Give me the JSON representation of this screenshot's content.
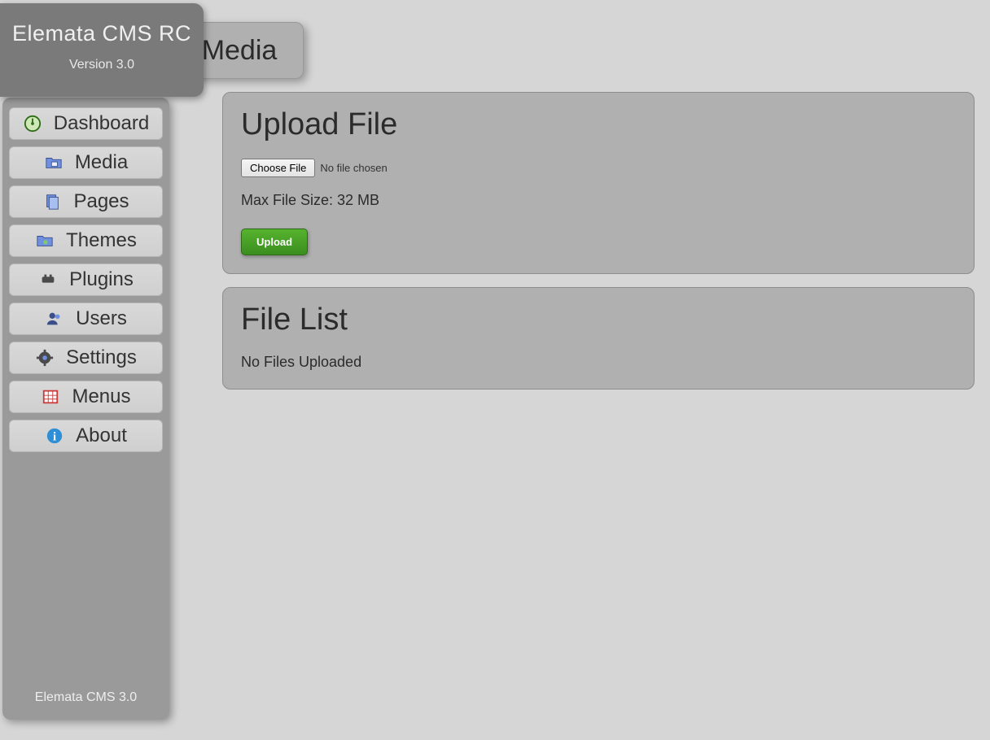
{
  "brand": {
    "title": "Elemata CMS RC",
    "version": "Version 3.0"
  },
  "sidebar": {
    "items": [
      {
        "label": "Dashboard",
        "icon": "dashboard-icon"
      },
      {
        "label": "Media",
        "icon": "media-icon"
      },
      {
        "label": "Pages",
        "icon": "pages-icon"
      },
      {
        "label": "Themes",
        "icon": "themes-icon"
      },
      {
        "label": "Plugins",
        "icon": "plugins-icon"
      },
      {
        "label": "Users",
        "icon": "users-icon"
      },
      {
        "label": "Settings",
        "icon": "settings-icon"
      },
      {
        "label": "Menus",
        "icon": "menus-icon"
      },
      {
        "label": "About",
        "icon": "about-icon"
      }
    ],
    "footer": "Elemata CMS 3.0"
  },
  "page": {
    "title": "Media"
  },
  "upload": {
    "heading": "Upload File",
    "choose_label": "Choose File",
    "file_status": "No file chosen",
    "max_size_text": "Max File Size: 32 MB",
    "button_label": "Upload"
  },
  "filelist": {
    "heading": "File List",
    "empty_message": "No Files Uploaded"
  }
}
